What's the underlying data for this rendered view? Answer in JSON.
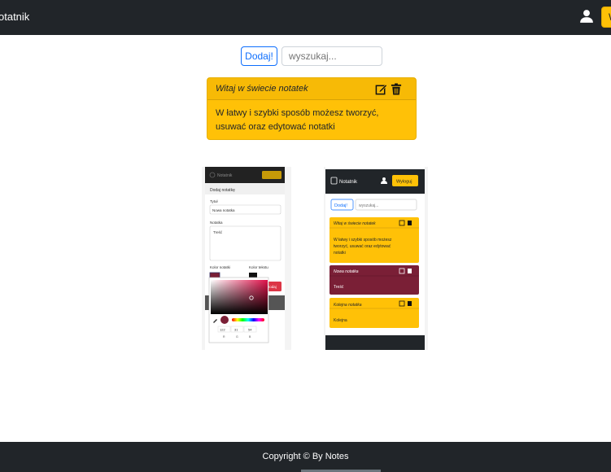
{
  "navbar": {
    "brand": "otatnik",
    "logout_label": "W"
  },
  "toolbar": {
    "add_label": "Dodaj!",
    "search_placeholder": "wyszukaj..."
  },
  "note": {
    "title": "Witaj w świecie notatek",
    "body": "W łatwy i szybki sposób możesz tworzyć, usuwać oraz edytować notatki",
    "color": "#ffc107"
  },
  "screenshot_left": {
    "brand": "Notatnik",
    "heading": "Dodaj notatkę",
    "title_label": "Tytuł",
    "title_value": "Nowa notatka",
    "content_label": "Notatka",
    "content_value": "Treść",
    "note_color_label": "Kolor notatki",
    "text_color_label": "Kolor tekstu",
    "submit_label": "Dodaj",
    "rgb_r": "122",
    "rgb_g": "31",
    "rgb_b": "54",
    "r_label": "R",
    "g_label": "G",
    "b_label": "B",
    "swatch_color": "#7a1f36"
  },
  "screenshot_right": {
    "brand": "Notatnik",
    "logout_label": "Wyloguj",
    "add_label": "Dodaj!",
    "search_placeholder": "wyszukaj...",
    "notes": [
      {
        "title": "Witaj w świecie notatek",
        "body": "W łatwy i szybki sposób możesz tworzyć, usuwać oraz edytować notatki",
        "bg": "#ffc107",
        "fg": "#212529"
      },
      {
        "title": "Nowa notatka",
        "body": "Treść",
        "bg": "#7a1f36",
        "fg": "#ffffff"
      },
      {
        "title": "Kolejna notatka",
        "body": "Kolejna",
        "bg": "#ffc107",
        "fg": "#212529"
      }
    ]
  },
  "footer": {
    "text": "Copyright © By Notes"
  }
}
